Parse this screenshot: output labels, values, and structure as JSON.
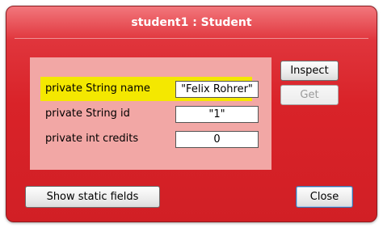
{
  "window": {
    "title": "student1 : Student"
  },
  "fields": [
    {
      "label": "private String name",
      "value": "\"Felix Rohrer\"",
      "highlighted": true
    },
    {
      "label": "private String id",
      "value": "\"1\"",
      "highlighted": false
    },
    {
      "label": "private int credits",
      "value": "0",
      "highlighted": false
    }
  ],
  "buttons": {
    "inspect": "Inspect",
    "get": "Get",
    "show_static_fields": "Show static fields",
    "close": "Close"
  },
  "colors": {
    "window_red": "#d92329",
    "panel_pink": "#f2a7a5",
    "highlight_yellow": "#f4e800"
  }
}
